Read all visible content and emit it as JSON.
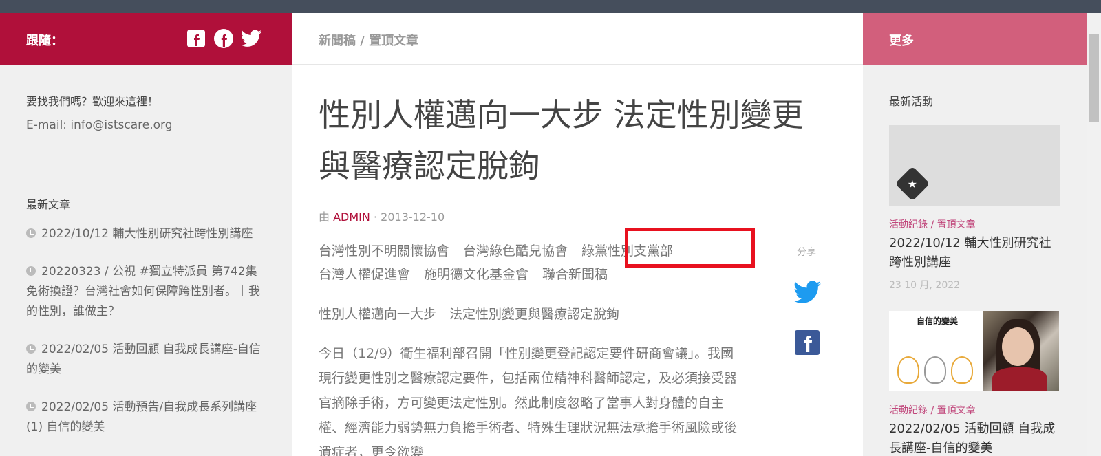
{
  "follow": {
    "label": "跟隨：",
    "icons": [
      "facebook-square-icon",
      "facebook-circle-icon",
      "twitter-icon"
    ]
  },
  "contact": {
    "line1": "要找我們嗎？歡迎來這裡！",
    "email": "E-mail: info@istscare.org"
  },
  "recent_posts": {
    "heading": "最新文章",
    "items": [
      "2022/10/12 輔大性別研究社跨性別講座",
      "20220323 / 公視 #獨立特派員 第742集 免術換證？台灣社會如何保障跨性別者。｜我的性別，誰做主？",
      "2022/02/05 活動回顧 自我成長講座-自信的變美",
      "2022/02/05 活動預告/自我成長系列講座(1) 自信的變美"
    ]
  },
  "breadcrumb": "新聞稿 / 置頂文章",
  "article": {
    "title": "性別人權邁向一大步 法定性別變更與醫療認定脫鉤",
    "by": "由",
    "author": "ADMIN",
    "date": "2013-12-10",
    "tags": [
      "台灣性別不明關懷協會",
      "台灣綠色酷兒協會",
      "綠黨性別支黨部",
      "台灣人權促進會",
      "施明德文化基金會",
      "聯合新聞稿"
    ],
    "subtitle": "性別人權邁向一大步　法定性別變更與醫療認定脫鉤",
    "body": "今日（12/9）衛生福利部召開「性別變更登記認定要件研商會議」。我國現行變更性別之醫療認定要件，包括兩位精神科醫師認定，及必須接受器官摘除手術，方可變更法定性別。然此制度忽略了當事人對身體的自主權、經濟能力弱勢無力負擔手術者、特殊生理狀況無法承擔手術風險或後遺症者，更令欲變"
  },
  "share": {
    "label": "分享"
  },
  "more": {
    "label": "更多"
  },
  "events": {
    "heading": "最新活動",
    "items": [
      {
        "category": "活動紀錄 / 置頂文章",
        "title": "2022/10/12 輔大性別研究社跨性別講座",
        "date": "23 10 月, 2022"
      },
      {
        "category": "活動紀錄 / 置頂文章",
        "title": "2022/02/05 活動回顧 自我成長講座-自信的變美",
        "thumb_text": "自信的變美"
      }
    ]
  },
  "colors": {
    "follow_bar": "#b0103a",
    "more_bar": "#d25f7c",
    "highlight_box": "#e8111f",
    "top_bar": "#454e5c"
  }
}
